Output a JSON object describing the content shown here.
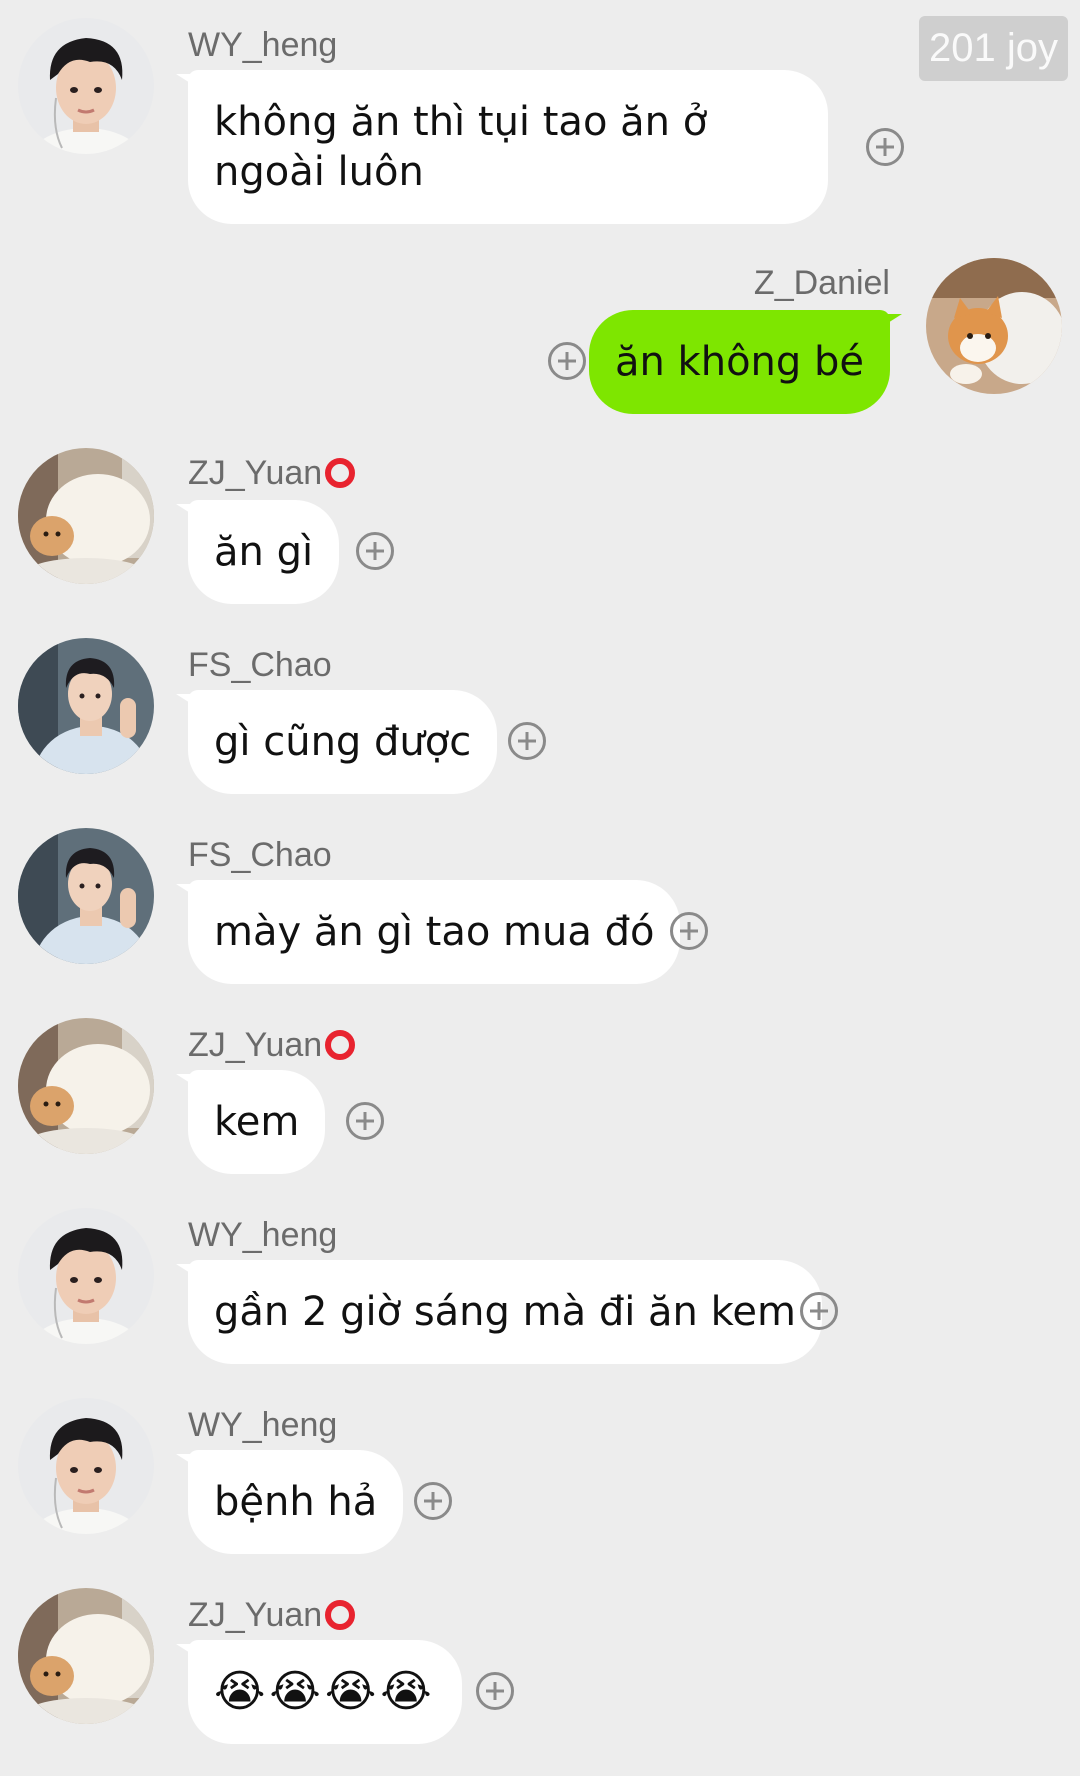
{
  "watermark": "201 joy",
  "messages": [
    {
      "sender": "WY_heng",
      "text": "không ăn thì tụi tao ăn ở ngoài luôn",
      "side": "left",
      "avatar": "boy-headphones"
    },
    {
      "sender": "Z_Daniel",
      "text": "ăn không bé",
      "side": "right",
      "avatar": "orange-cat"
    },
    {
      "sender": "ZJ_Yuan",
      "text": "ăn gì",
      "side": "left",
      "avatar": "white-cat"
    },
    {
      "sender": "FS_Chao",
      "text": "gì cũng được",
      "side": "left",
      "avatar": "boy-sweater"
    },
    {
      "sender": "FS_Chao",
      "text": "mày ăn gì tao mua đó",
      "side": "left",
      "avatar": "boy-sweater"
    },
    {
      "sender": "ZJ_Yuan",
      "text": "kem",
      "side": "left",
      "avatar": "white-cat"
    },
    {
      "sender": "WY_heng",
      "text": "gần 2 giờ sáng mà đi ăn kem",
      "side": "left",
      "avatar": "boy-headphones"
    },
    {
      "sender": "WY_heng",
      "text": "bệnh hả",
      "side": "left",
      "avatar": "boy-headphones"
    },
    {
      "sender": "ZJ_Yuan",
      "text": "😭😭😭😭",
      "side": "left",
      "avatar": "white-cat"
    }
  ],
  "colors": {
    "background": "#ededed",
    "bubble_left": "#ffffff",
    "bubble_right": "#7ee600",
    "name_ring": "#e8232f"
  },
  "icons": {
    "react": "plus-circle-icon"
  }
}
